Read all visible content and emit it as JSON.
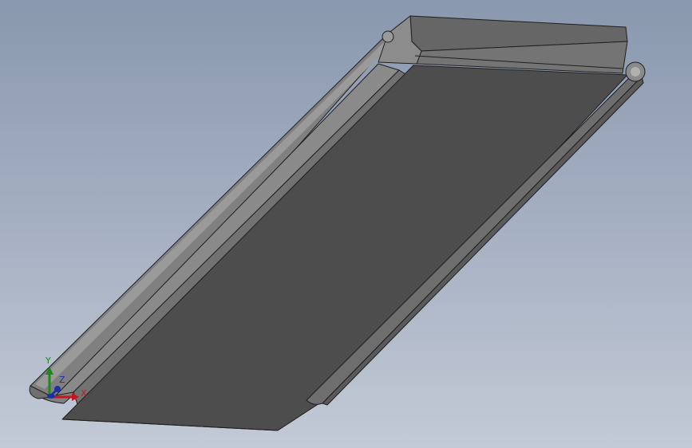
{
  "viewport": {
    "name": "3d-graphics-area",
    "background_top": "#8998ae",
    "background_bottom": "#c3cad6"
  },
  "model": {
    "name": "extruded-tray-part",
    "top_face_color": "#4d4d4d",
    "side_face_color": "#6e6e6e",
    "edge_color": "#1f1f1f"
  },
  "triad": {
    "x_label": "X",
    "y_label": "Y",
    "z_label": "Z",
    "x_color": "#c4161c",
    "y_color": "#1a8a1a",
    "z_color": "#1c2fa8"
  }
}
